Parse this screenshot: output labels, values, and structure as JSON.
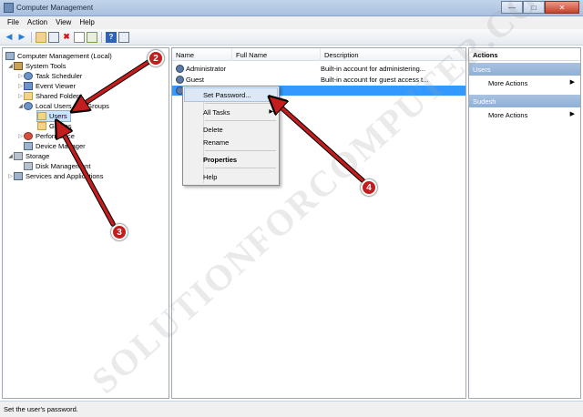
{
  "window": {
    "title": "Computer Management"
  },
  "menubar": [
    "File",
    "Action",
    "View",
    "Help"
  ],
  "toolbar": {
    "icons": [
      "back-icon",
      "forward-icon",
      "up-folder-icon",
      "show-hide-tree-icon",
      "delete-icon",
      "properties-icon",
      "export-icon",
      "help-icon",
      "show-hide-action-pane-icon"
    ]
  },
  "tree": {
    "root": "Computer Management (Local)",
    "system_tools": "System Tools",
    "task_scheduler": "Task Scheduler",
    "event_viewer": "Event Viewer",
    "shared_folders": "Shared Folders",
    "local_users_groups": "Local Users and Groups",
    "users": "Users",
    "groups": "Groups",
    "performance": "Performance",
    "device_manager": "Device Manager",
    "storage": "Storage",
    "disk_management": "Disk Management",
    "services_apps": "Services and Applications"
  },
  "list": {
    "headers": [
      "Name",
      "Full Name",
      "Description"
    ],
    "rows": [
      {
        "name": "Administrator",
        "full_name": "",
        "description": "Built-in account for administering..."
      },
      {
        "name": "Guest",
        "full_name": "",
        "description": "Built-in account for guest access t..."
      },
      {
        "name": "",
        "full_name": "",
        "description": ""
      }
    ]
  },
  "actions": {
    "header": "Actions",
    "sections": [
      {
        "title": "Users",
        "item": "More Actions"
      },
      {
        "title": "Sudesh",
        "item": "More Actions"
      }
    ]
  },
  "context_menu": {
    "set_password": "Set Password...",
    "all_tasks": "All Tasks",
    "delete": "Delete",
    "rename": "Rename",
    "properties": "Properties",
    "help": "Help"
  },
  "status": "Set the user's password.",
  "annotations": {
    "badges": [
      "2",
      "3",
      "4"
    ],
    "color": "#c31d1d"
  },
  "watermark": "SOLUTIONFORCOMPUTER.COM"
}
